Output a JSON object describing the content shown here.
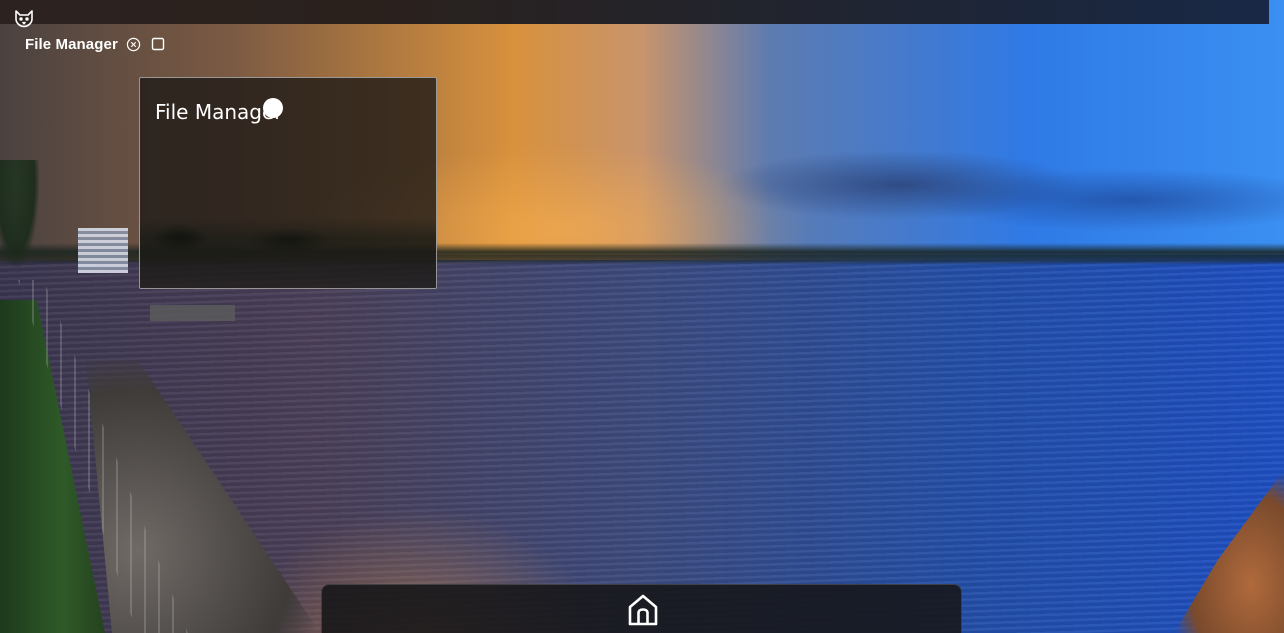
{
  "topbar": {
    "logo_icon": "fox-logo-icon"
  },
  "app": {
    "title": "File Manager",
    "close_icon": "close-circle-icon",
    "maximize_icon": "maximize-square-icon"
  },
  "window": {
    "title": "File Manager"
  },
  "dock": {
    "home_icon": "home-icon"
  },
  "colors": {
    "topbar_left": "#2c2320",
    "topbar_right": "#182846",
    "window_bg": "#211c18",
    "dock_bg": "#161618",
    "text": "#ffffff"
  }
}
